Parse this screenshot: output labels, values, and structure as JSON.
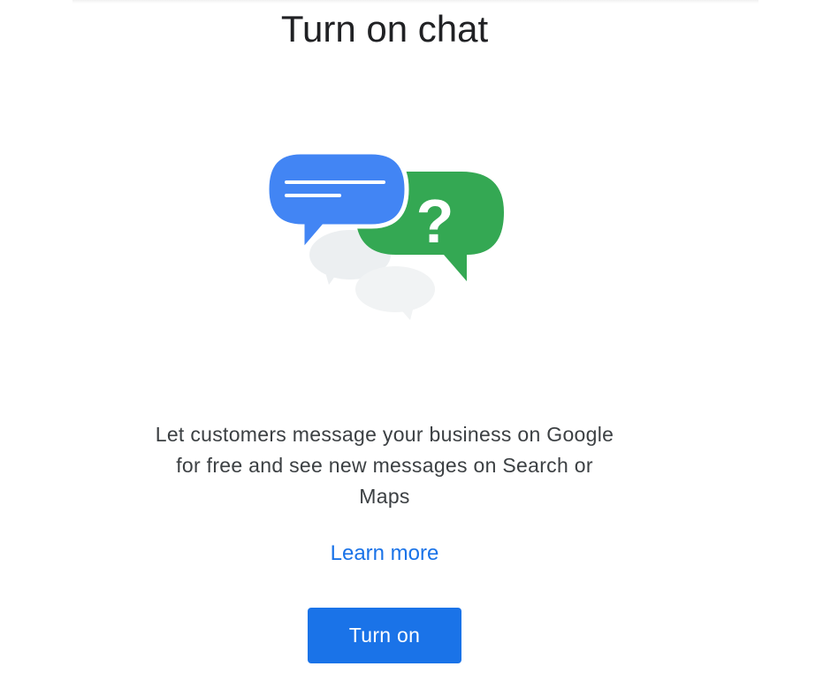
{
  "page": {
    "title": "Turn on chat"
  },
  "illustration": {
    "icon": "chat-bubbles-question-illustration",
    "question_mark": "?",
    "colors": {
      "blue_bubble": "#4285f4",
      "green_bubble": "#34a853",
      "grey_bubble": "#f1f3f4",
      "white_line": "#ffffff"
    }
  },
  "description": {
    "line1": "Let customers message your business on Google",
    "line2": "for free and see new messages on Search or",
    "line3": "Maps"
  },
  "links": {
    "learn_more": "Learn more"
  },
  "actions": {
    "turn_on_label": "Turn on"
  },
  "colors": {
    "accent": "#1a73e8",
    "text_primary": "#202124",
    "text_secondary": "#3c4043"
  }
}
